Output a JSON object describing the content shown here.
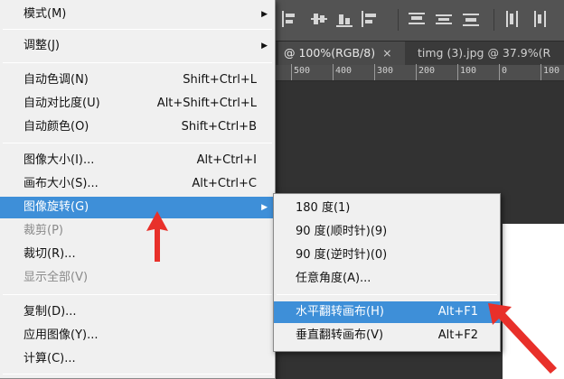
{
  "main_menu": {
    "items": [
      {
        "label": "模式(M)",
        "shortcut": "",
        "submenu": true,
        "disabled": false
      },
      {
        "label": "调整(J)",
        "shortcut": "",
        "submenu": true,
        "disabled": false
      },
      {
        "label": "自动色调(N)",
        "shortcut": "Shift+Ctrl+L",
        "submenu": false,
        "disabled": false
      },
      {
        "label": "自动对比度(U)",
        "shortcut": "Alt+Shift+Ctrl+L",
        "submenu": false,
        "disabled": false
      },
      {
        "label": "自动颜色(O)",
        "shortcut": "Shift+Ctrl+B",
        "submenu": false,
        "disabled": false
      },
      {
        "label": "图像大小(I)...",
        "shortcut": "Alt+Ctrl+I",
        "submenu": false,
        "disabled": false
      },
      {
        "label": "画布大小(S)...",
        "shortcut": "Alt+Ctrl+C",
        "submenu": false,
        "disabled": false
      },
      {
        "label": "图像旋转(G)",
        "shortcut": "",
        "submenu": true,
        "disabled": false,
        "highlighted": true
      },
      {
        "label": "裁剪(P)",
        "shortcut": "",
        "submenu": false,
        "disabled": true
      },
      {
        "label": "裁切(R)...",
        "shortcut": "",
        "submenu": false,
        "disabled": false
      },
      {
        "label": "显示全部(V)",
        "shortcut": "",
        "submenu": false,
        "disabled": true
      },
      {
        "label": "复制(D)...",
        "shortcut": "",
        "submenu": false,
        "disabled": false
      },
      {
        "label": "应用图像(Y)...",
        "shortcut": "",
        "submenu": false,
        "disabled": false
      },
      {
        "label": "计算(C)...",
        "shortcut": "",
        "submenu": false,
        "disabled": false
      }
    ]
  },
  "rotate_submenu": {
    "items": [
      {
        "label": "180 度(1)",
        "shortcut": ""
      },
      {
        "label": "90 度(顺时针)(9)",
        "shortcut": ""
      },
      {
        "label": "90 度(逆时针)(0)",
        "shortcut": ""
      },
      {
        "label": "任意角度(A)...",
        "shortcut": ""
      },
      {
        "label": "水平翻转画布(H)",
        "shortcut": "Alt+F1",
        "highlighted": true
      },
      {
        "label": "垂直翻转画布(V)",
        "shortcut": "Alt+F2"
      }
    ]
  },
  "tabs": [
    {
      "label": "@ 100%(RGB/8)",
      "close": "×",
      "active": true
    },
    {
      "label": "timg (3).jpg @ 37.9%(R",
      "close": "",
      "active": false
    }
  ],
  "ruler": {
    "labels": [
      "500",
      "400",
      "300",
      "200",
      "100",
      "0",
      "100"
    ]
  },
  "icons": {
    "submenu_arrow": "chevron-right-icon",
    "close": "close-icon"
  },
  "colors": {
    "highlight": "#3e8fd8",
    "annotation": "#e8302a",
    "menu_bg": "#f0f0f0",
    "app_bg": "#323232"
  }
}
